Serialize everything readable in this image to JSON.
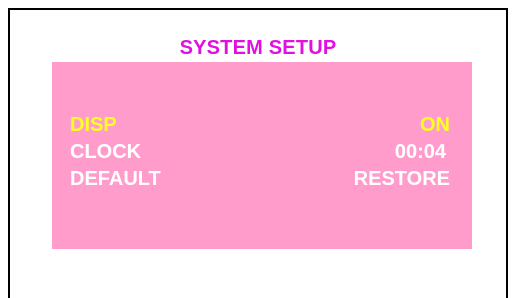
{
  "screen": {
    "title": "SYSTEM SETUP",
    "colors": {
      "title": "#e010e0",
      "panel_background": "#ff9ccc",
      "selected_text": "#ffff22",
      "normal_text": "#ffffff",
      "frame_border": "#000000"
    }
  },
  "menu": {
    "items": [
      {
        "label": "DISP",
        "value": "ON",
        "selected": true
      },
      {
        "label": "CLOCK",
        "value": "00:04",
        "selected": false
      },
      {
        "label": "DEFAULT",
        "value": "RESTORE",
        "selected": false
      }
    ]
  }
}
